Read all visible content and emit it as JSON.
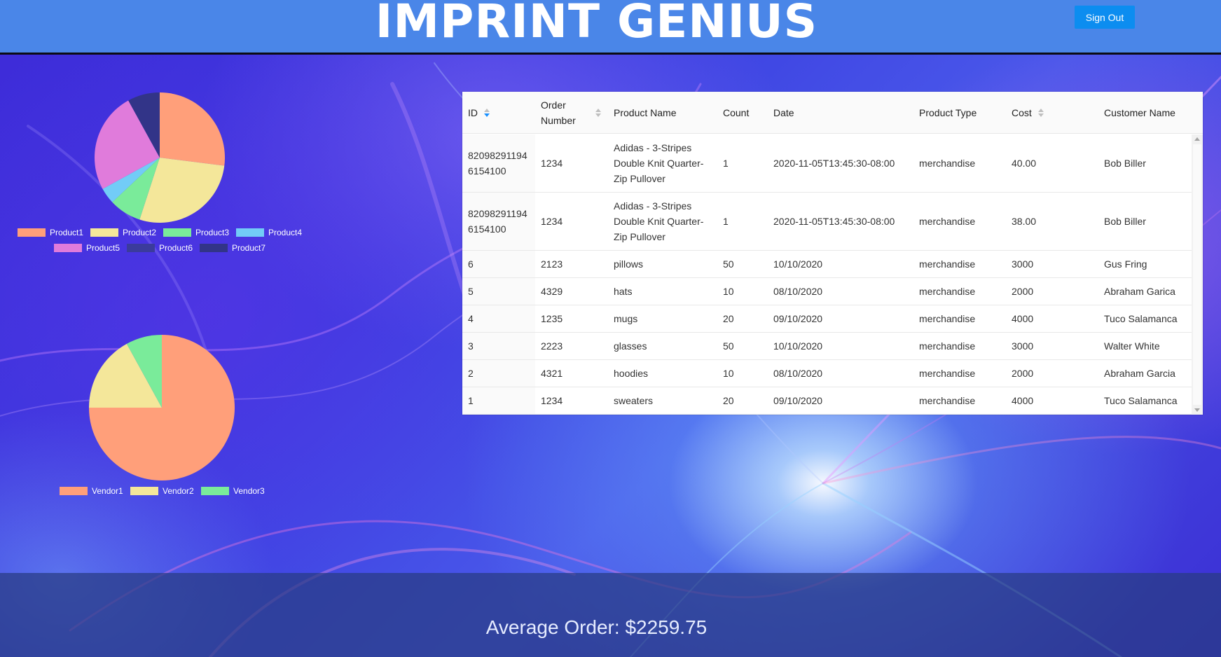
{
  "header": {
    "logo": "IMPRINT GENIUS",
    "sign_out_label": "Sign Out"
  },
  "chart_data": [
    {
      "type": "pie",
      "labels": [
        "Product1",
        "Product2",
        "Product3",
        "Product4",
        "Product5",
        "Product6",
        "Product7"
      ],
      "values": [
        27,
        28,
        8,
        4,
        25,
        0,
        8
      ],
      "colors": [
        "#ff9f7a",
        "#f4e79a",
        "#7aeb9a",
        "#72ccf7",
        "#e07bdb",
        "#3b3b9c",
        "#323488"
      ]
    },
    {
      "type": "pie",
      "labels": [
        "Vendor1",
        "Vendor2",
        "Vendor3"
      ],
      "values": [
        75,
        17,
        8
      ],
      "colors": [
        "#ff9f7a",
        "#f4e79a",
        "#7aeb9a"
      ]
    }
  ],
  "table": {
    "columns": [
      "ID",
      "Order Number",
      "Product Name",
      "Count",
      "Date",
      "Product Type",
      "Cost",
      "Customer Name"
    ],
    "rows": [
      [
        "820982911946154100",
        "1234",
        "Adidas - 3-Stripes Double Knit Quarter-Zip Pullover",
        "1",
        "2020-11-05T13:45:30-08:00",
        "merchandise",
        "40.00",
        "Bob Biller"
      ],
      [
        "820982911946154100",
        "1234",
        "Adidas - 3-Stripes Double Knit Quarter-Zip Pullover",
        "1",
        "2020-11-05T13:45:30-08:00",
        "merchandise",
        "38.00",
        "Bob Biller"
      ],
      [
        "6",
        "2123",
        "pillows",
        "50",
        "10/10/2020",
        "merchandise",
        "3000",
        "Gus Fring"
      ],
      [
        "5",
        "4329",
        "hats",
        "10",
        "08/10/2020",
        "merchandise",
        "2000",
        "Abraham Garica"
      ],
      [
        "4",
        "1235",
        "mugs",
        "20",
        "09/10/2020",
        "merchandise",
        "4000",
        "Tuco Salamanca"
      ],
      [
        "3",
        "2223",
        "glasses",
        "50",
        "10/10/2020",
        "merchandise",
        "3000",
        "Walter White"
      ],
      [
        "2",
        "4321",
        "hoodies",
        "10",
        "08/10/2020",
        "merchandise",
        "2000",
        "Abraham Garcia"
      ],
      [
        "1",
        "1234",
        "sweaters",
        "20",
        "09/10/2020",
        "merchandise",
        "4000",
        "Tuco Salamanca"
      ]
    ]
  },
  "footer": {
    "average_order": "Average Order: $2259.75"
  }
}
